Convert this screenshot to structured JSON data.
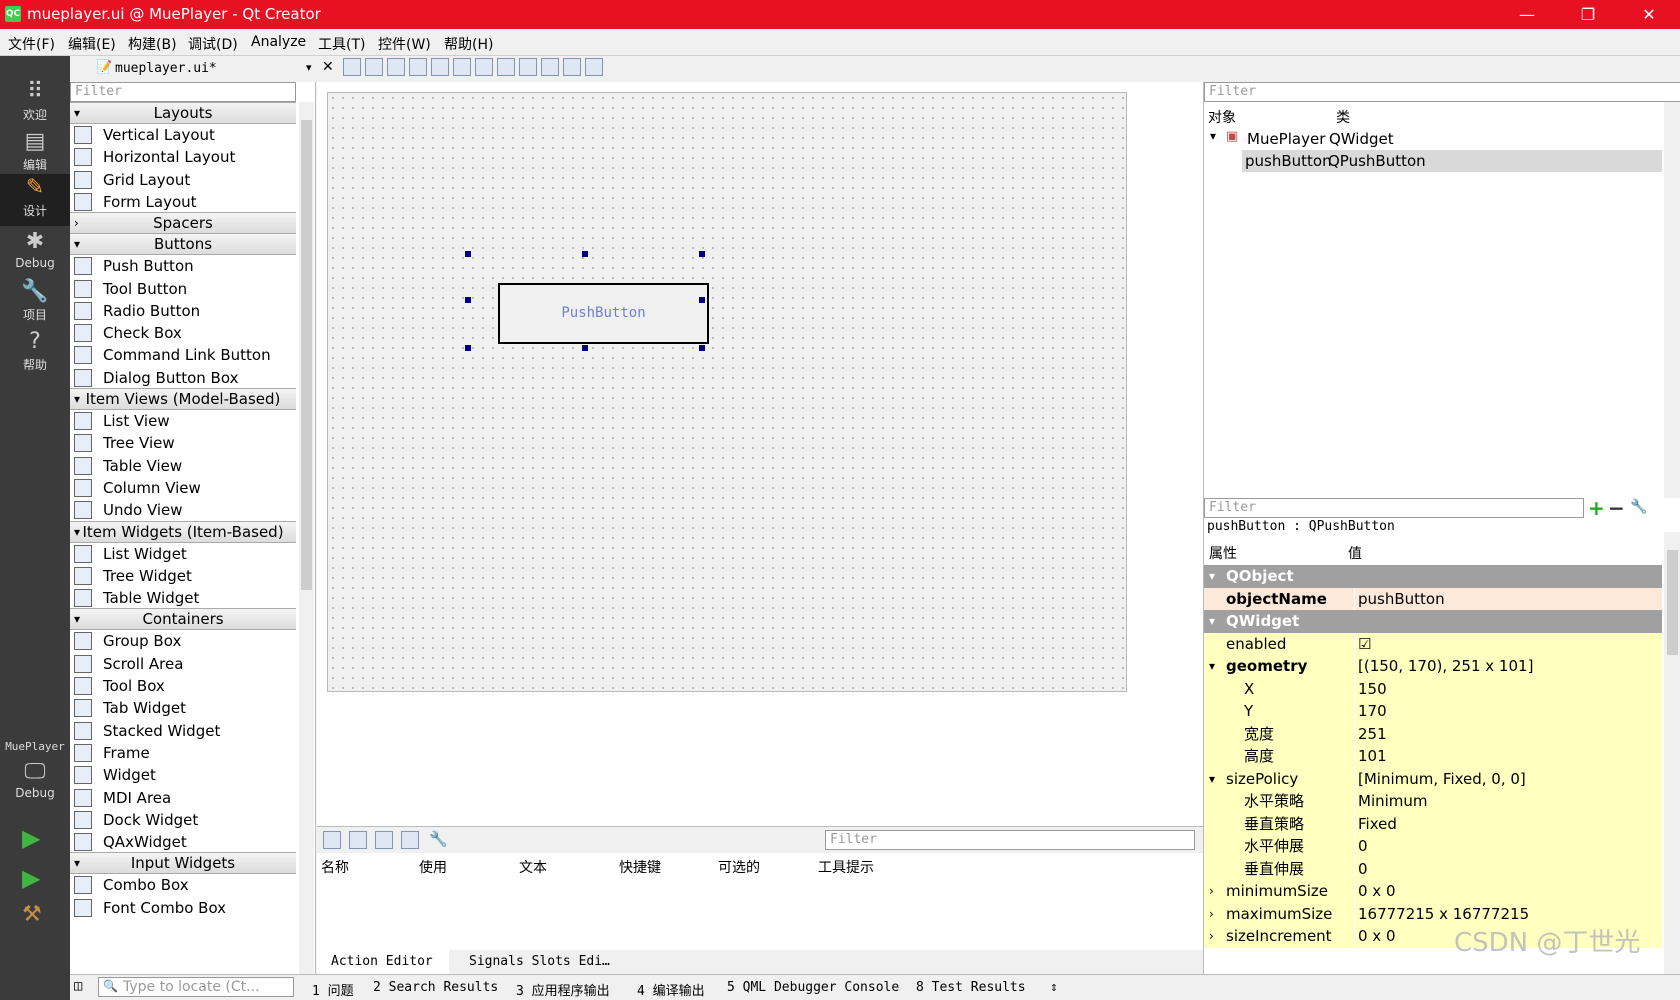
{
  "window": {
    "title": "mueplayer.ui @ MuePlayer - Qt Creator",
    "app_icon": "QC",
    "minimize": "—",
    "maximize": "❐",
    "close": "✕"
  },
  "menu": [
    "文件(F)",
    "编辑(E)",
    "构建(B)",
    "调试(D)",
    "Analyze",
    "工具(T)",
    "控件(W)",
    "帮助(H)"
  ],
  "modes": [
    {
      "label": "欢迎",
      "icon": "grid-icon"
    },
    {
      "label": "编辑",
      "icon": "edit-doc-icon"
    },
    {
      "label": "设计",
      "icon": "pencil-icon"
    },
    {
      "label": "Debug",
      "icon": "bug-icon"
    },
    {
      "label": "项目",
      "icon": "wrench-icon"
    },
    {
      "label": "帮助",
      "icon": "help-icon"
    }
  ],
  "run_panel": {
    "project": "MuePlayer",
    "config": "Debug"
  },
  "editor": {
    "file_tab": "mueplayer.ui*"
  },
  "widgetbox": {
    "filter_placeholder": "Filter",
    "categories": [
      {
        "name": "Layouts",
        "items": [
          "Vertical Layout",
          "Horizontal Layout",
          "Grid Layout",
          "Form Layout"
        ]
      },
      {
        "name": "Spacers",
        "items": []
      },
      {
        "name": "Buttons",
        "items": [
          "Push Button",
          "Tool Button",
          "Radio Button",
          "Check Box",
          "Command Link Button",
          "Dialog Button Box"
        ]
      },
      {
        "name": "Item Views (Model-Based)",
        "items": [
          "List View",
          "Tree View",
          "Table View",
          "Column View",
          "Undo View"
        ]
      },
      {
        "name": "Item Widgets (Item-Based)",
        "items": [
          "List Widget",
          "Tree Widget",
          "Table Widget"
        ]
      },
      {
        "name": "Containers",
        "items": [
          "Group Box",
          "Scroll Area",
          "Tool Box",
          "Tab Widget",
          "Stacked Widget",
          "Frame",
          "Widget",
          "MDI Area",
          "Dock Widget",
          "QAxWidget"
        ]
      },
      {
        "name": "Input Widgets",
        "items": [
          "Combo Box",
          "Font Combo Box"
        ]
      }
    ]
  },
  "form": {
    "button_text": "PushButton"
  },
  "action_editor": {
    "filter_placeholder": "Filter",
    "columns": [
      "名称",
      "使用",
      "文本",
      "快捷键",
      "可选的",
      "工具提示"
    ],
    "tabs": [
      "Action Editor",
      "Signals  Slots Edi…"
    ]
  },
  "object_inspector": {
    "filter_placeholder": "Filter",
    "col_object": "对象",
    "col_class": "类",
    "rows": [
      {
        "object": "MuePlayer",
        "class": "QWidget"
      },
      {
        "object": "pushButton",
        "class": "QPushButton"
      }
    ]
  },
  "property_editor": {
    "filter_placeholder": "Filter",
    "context": "pushButton : QPushButton",
    "col_property": "属性",
    "col_value": "值",
    "rows": [
      {
        "name": "QObject",
        "value": "",
        "type": "section"
      },
      {
        "name": "objectName",
        "value": "pushButton",
        "type": "bold"
      },
      {
        "name": "QWidget",
        "value": "",
        "type": "section"
      },
      {
        "name": "enabled",
        "value": "☑",
        "type": "plain"
      },
      {
        "name": "geometry",
        "value": "[(150, 170), 251 x 101]",
        "type": "bold-expand"
      },
      {
        "name": "X",
        "value": "150",
        "type": "child"
      },
      {
        "name": "Y",
        "value": "170",
        "type": "child"
      },
      {
        "name": "宽度",
        "value": "251",
        "type": "child"
      },
      {
        "name": "高度",
        "value": "101",
        "type": "child"
      },
      {
        "name": "sizePolicy",
        "value": "[Minimum, Fixed, 0, 0]",
        "type": "expand"
      },
      {
        "name": "水平策略",
        "value": "Minimum",
        "type": "child"
      },
      {
        "name": "垂直策略",
        "value": "Fixed",
        "type": "child"
      },
      {
        "name": "水平伸展",
        "value": "0",
        "type": "child"
      },
      {
        "name": "垂直伸展",
        "value": "0",
        "type": "child"
      },
      {
        "name": "minimumSize",
        "value": "0 x 0",
        "type": "collapsed"
      },
      {
        "name": "maximumSize",
        "value": "16777215 x 16777215",
        "type": "collapsed"
      },
      {
        "name": "sizeIncrement",
        "value": "0 x 0",
        "type": "collapsed"
      }
    ]
  },
  "statusbar": {
    "locate_placeholder": "Type to locate (Ct...",
    "items": [
      "1  问题",
      "2  Search Results",
      "3  应用程序输出",
      "4  编译输出",
      "5  QML Debugger Console",
      "8  Test Results"
    ]
  },
  "watermark": "CSDN @丁世光"
}
